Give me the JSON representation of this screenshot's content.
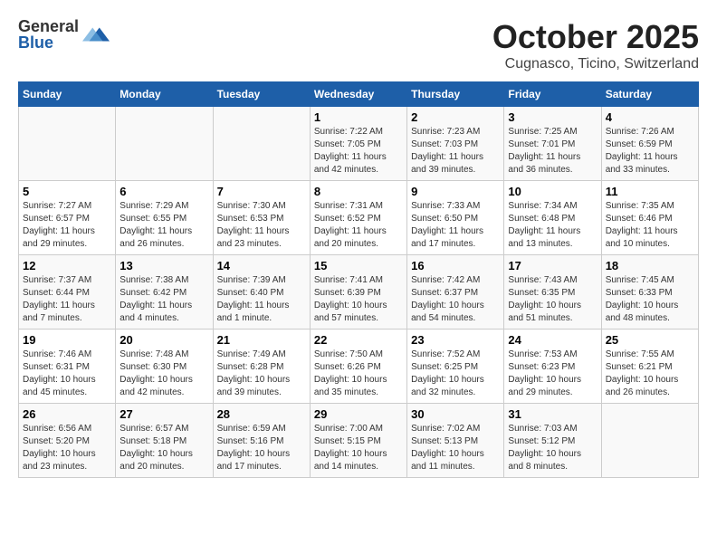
{
  "header": {
    "logo_general": "General",
    "logo_blue": "Blue",
    "title": "October 2025",
    "subtitle": "Cugnasco, Ticino, Switzerland"
  },
  "days_of_week": [
    "Sunday",
    "Monday",
    "Tuesday",
    "Wednesday",
    "Thursday",
    "Friday",
    "Saturday"
  ],
  "weeks": [
    {
      "days": [
        {
          "number": "",
          "info": ""
        },
        {
          "number": "",
          "info": ""
        },
        {
          "number": "",
          "info": ""
        },
        {
          "number": "1",
          "info": "Sunrise: 7:22 AM\nSunset: 7:05 PM\nDaylight: 11 hours and 42 minutes."
        },
        {
          "number": "2",
          "info": "Sunrise: 7:23 AM\nSunset: 7:03 PM\nDaylight: 11 hours and 39 minutes."
        },
        {
          "number": "3",
          "info": "Sunrise: 7:25 AM\nSunset: 7:01 PM\nDaylight: 11 hours and 36 minutes."
        },
        {
          "number": "4",
          "info": "Sunrise: 7:26 AM\nSunset: 6:59 PM\nDaylight: 11 hours and 33 minutes."
        }
      ]
    },
    {
      "days": [
        {
          "number": "5",
          "info": "Sunrise: 7:27 AM\nSunset: 6:57 PM\nDaylight: 11 hours and 29 minutes."
        },
        {
          "number": "6",
          "info": "Sunrise: 7:29 AM\nSunset: 6:55 PM\nDaylight: 11 hours and 26 minutes."
        },
        {
          "number": "7",
          "info": "Sunrise: 7:30 AM\nSunset: 6:53 PM\nDaylight: 11 hours and 23 minutes."
        },
        {
          "number": "8",
          "info": "Sunrise: 7:31 AM\nSunset: 6:52 PM\nDaylight: 11 hours and 20 minutes."
        },
        {
          "number": "9",
          "info": "Sunrise: 7:33 AM\nSunset: 6:50 PM\nDaylight: 11 hours and 17 minutes."
        },
        {
          "number": "10",
          "info": "Sunrise: 7:34 AM\nSunset: 6:48 PM\nDaylight: 11 hours and 13 minutes."
        },
        {
          "number": "11",
          "info": "Sunrise: 7:35 AM\nSunset: 6:46 PM\nDaylight: 11 hours and 10 minutes."
        }
      ]
    },
    {
      "days": [
        {
          "number": "12",
          "info": "Sunrise: 7:37 AM\nSunset: 6:44 PM\nDaylight: 11 hours and 7 minutes."
        },
        {
          "number": "13",
          "info": "Sunrise: 7:38 AM\nSunset: 6:42 PM\nDaylight: 11 hours and 4 minutes."
        },
        {
          "number": "14",
          "info": "Sunrise: 7:39 AM\nSunset: 6:40 PM\nDaylight: 11 hours and 1 minute."
        },
        {
          "number": "15",
          "info": "Sunrise: 7:41 AM\nSunset: 6:39 PM\nDaylight: 10 hours and 57 minutes."
        },
        {
          "number": "16",
          "info": "Sunrise: 7:42 AM\nSunset: 6:37 PM\nDaylight: 10 hours and 54 minutes."
        },
        {
          "number": "17",
          "info": "Sunrise: 7:43 AM\nSunset: 6:35 PM\nDaylight: 10 hours and 51 minutes."
        },
        {
          "number": "18",
          "info": "Sunrise: 7:45 AM\nSunset: 6:33 PM\nDaylight: 10 hours and 48 minutes."
        }
      ]
    },
    {
      "days": [
        {
          "number": "19",
          "info": "Sunrise: 7:46 AM\nSunset: 6:31 PM\nDaylight: 10 hours and 45 minutes."
        },
        {
          "number": "20",
          "info": "Sunrise: 7:48 AM\nSunset: 6:30 PM\nDaylight: 10 hours and 42 minutes."
        },
        {
          "number": "21",
          "info": "Sunrise: 7:49 AM\nSunset: 6:28 PM\nDaylight: 10 hours and 39 minutes."
        },
        {
          "number": "22",
          "info": "Sunrise: 7:50 AM\nSunset: 6:26 PM\nDaylight: 10 hours and 35 minutes."
        },
        {
          "number": "23",
          "info": "Sunrise: 7:52 AM\nSunset: 6:25 PM\nDaylight: 10 hours and 32 minutes."
        },
        {
          "number": "24",
          "info": "Sunrise: 7:53 AM\nSunset: 6:23 PM\nDaylight: 10 hours and 29 minutes."
        },
        {
          "number": "25",
          "info": "Sunrise: 7:55 AM\nSunset: 6:21 PM\nDaylight: 10 hours and 26 minutes."
        }
      ]
    },
    {
      "days": [
        {
          "number": "26",
          "info": "Sunrise: 6:56 AM\nSunset: 5:20 PM\nDaylight: 10 hours and 23 minutes."
        },
        {
          "number": "27",
          "info": "Sunrise: 6:57 AM\nSunset: 5:18 PM\nDaylight: 10 hours and 20 minutes."
        },
        {
          "number": "28",
          "info": "Sunrise: 6:59 AM\nSunset: 5:16 PM\nDaylight: 10 hours and 17 minutes."
        },
        {
          "number": "29",
          "info": "Sunrise: 7:00 AM\nSunset: 5:15 PM\nDaylight: 10 hours and 14 minutes."
        },
        {
          "number": "30",
          "info": "Sunrise: 7:02 AM\nSunset: 5:13 PM\nDaylight: 10 hours and 11 minutes."
        },
        {
          "number": "31",
          "info": "Sunrise: 7:03 AM\nSunset: 5:12 PM\nDaylight: 10 hours and 8 minutes."
        },
        {
          "number": "",
          "info": ""
        }
      ]
    }
  ]
}
